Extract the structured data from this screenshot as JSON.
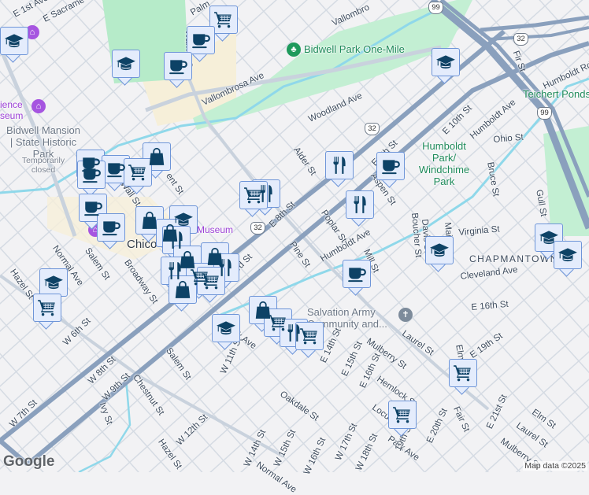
{
  "map": {
    "streets": [
      "E 1st Ave",
      "E Sacrame",
      "Palm",
      "Warner St",
      "Vallombrosa Ave",
      "Vallombro",
      "Woodland Ave",
      "E 10th St",
      "Humboldt Ave",
      "Humboldt Rd",
      "Fir St",
      "Ohio St",
      "Bruce St",
      "Gull St",
      "Alder St",
      "E 8th St",
      "Aspen St",
      "Poplar St",
      "Pine St",
      "Humboldt Ave",
      "Mill St",
      "Boucher St",
      "Virginia St",
      "Cleveland Ave",
      "E 16th St",
      "Laurel St",
      "E 19th St",
      "Elm St",
      "Mulberry St",
      "E 14th St",
      "E 15th St",
      "E 16th St",
      "Hemlock St",
      "E 20th St",
      "Fair St",
      "E 21st St",
      "Elm St",
      "Laurel St",
      "Mulberry St",
      "Park Ave",
      "E 8th St",
      "Normal Ave",
      "Salem St",
      "Broadway St",
      "W 6th St",
      "W 8th St",
      "W 9th St",
      "W 7th St",
      "Chestnut St",
      "Salem St",
      "W 11th St",
      "Ivy St",
      "W 12th St",
      "Hazel St",
      "Oakdale St",
      "W 14th St",
      "W 15th St",
      "W 16th St",
      "W 17th St",
      "W 18th St",
      "Wall St",
      "ent St",
      "Davis St",
      "Main St",
      "Locust St",
      "Hazel St",
      "Normal Ave",
      "19th St",
      "Park Ave",
      "E 3rd St"
    ],
    "parks": {
      "bidwell_one_mile": "Bidwell Park One-Mile",
      "teichert": "Teichert Ponds",
      "humboldt": "Humboldt Park/ Windchime Park"
    },
    "neighborhood": "CHAPMANTOWN",
    "city": "Chico",
    "museum": "Museum",
    "science_museum": "ience\nseum",
    "bidwell_mansion": "Bidwell Mansion | State Historic Park",
    "temporarily_closed": "Temporarily closed",
    "salvation_army": "Salvation Army Community and...",
    "route_shields": [
      "32",
      "32",
      "32",
      "99",
      "99"
    ],
    "attribution": "Map data ©2025",
    "logo": "Google"
  }
}
